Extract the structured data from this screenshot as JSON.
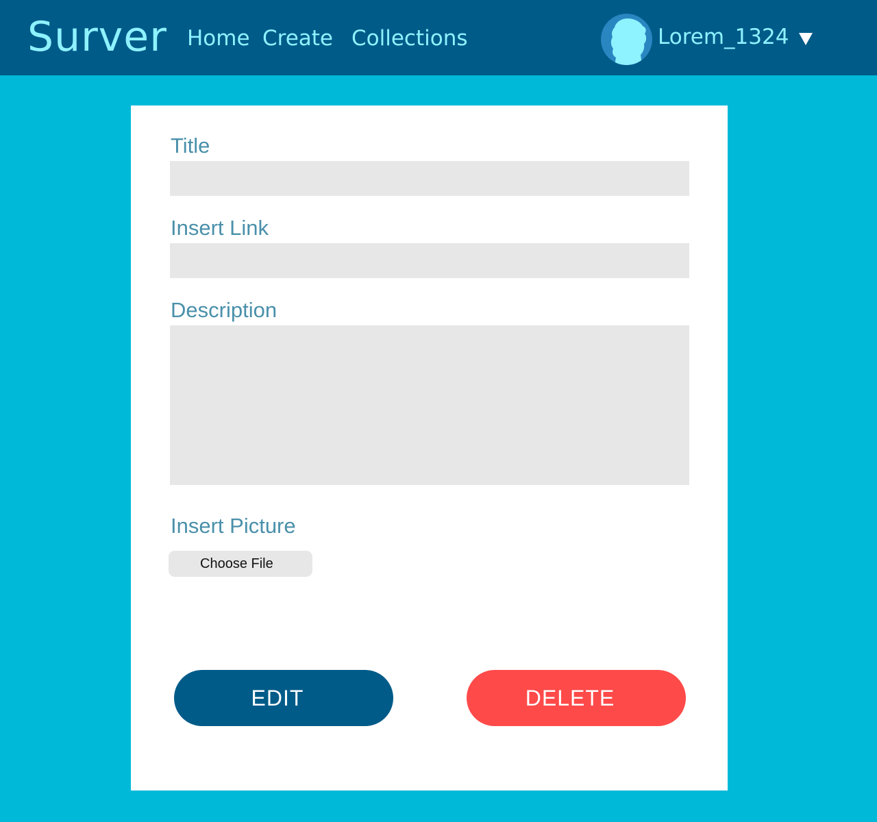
{
  "header": {
    "brand": "Surver",
    "nav": {
      "home": "Home",
      "create": "Create",
      "collections": "Collections"
    },
    "user": {
      "username": "Lorem_1324",
      "avatar_icon": "user-silhouette-icon",
      "menu_icon": "caret-down-icon"
    }
  },
  "form": {
    "title_label": "Title",
    "title_value": "",
    "link_label": "Insert Link",
    "link_value": "",
    "description_label": "Description",
    "description_value": "",
    "picture_label": "Insert Picture",
    "choose_file_label": "Choose File",
    "edit_label": "EDIT",
    "delete_label": "DELETE"
  },
  "colors": {
    "page_background": "#00b9d8",
    "navbar": "#005b88",
    "nav_text": "#8ef2ff",
    "avatar_background": "#2a86c1",
    "card": "#ffffff",
    "label_text": "#4a90aa",
    "field_background": "#e7e7e7",
    "edit_button": "#005b88",
    "delete_button": "#ff4a4a"
  }
}
